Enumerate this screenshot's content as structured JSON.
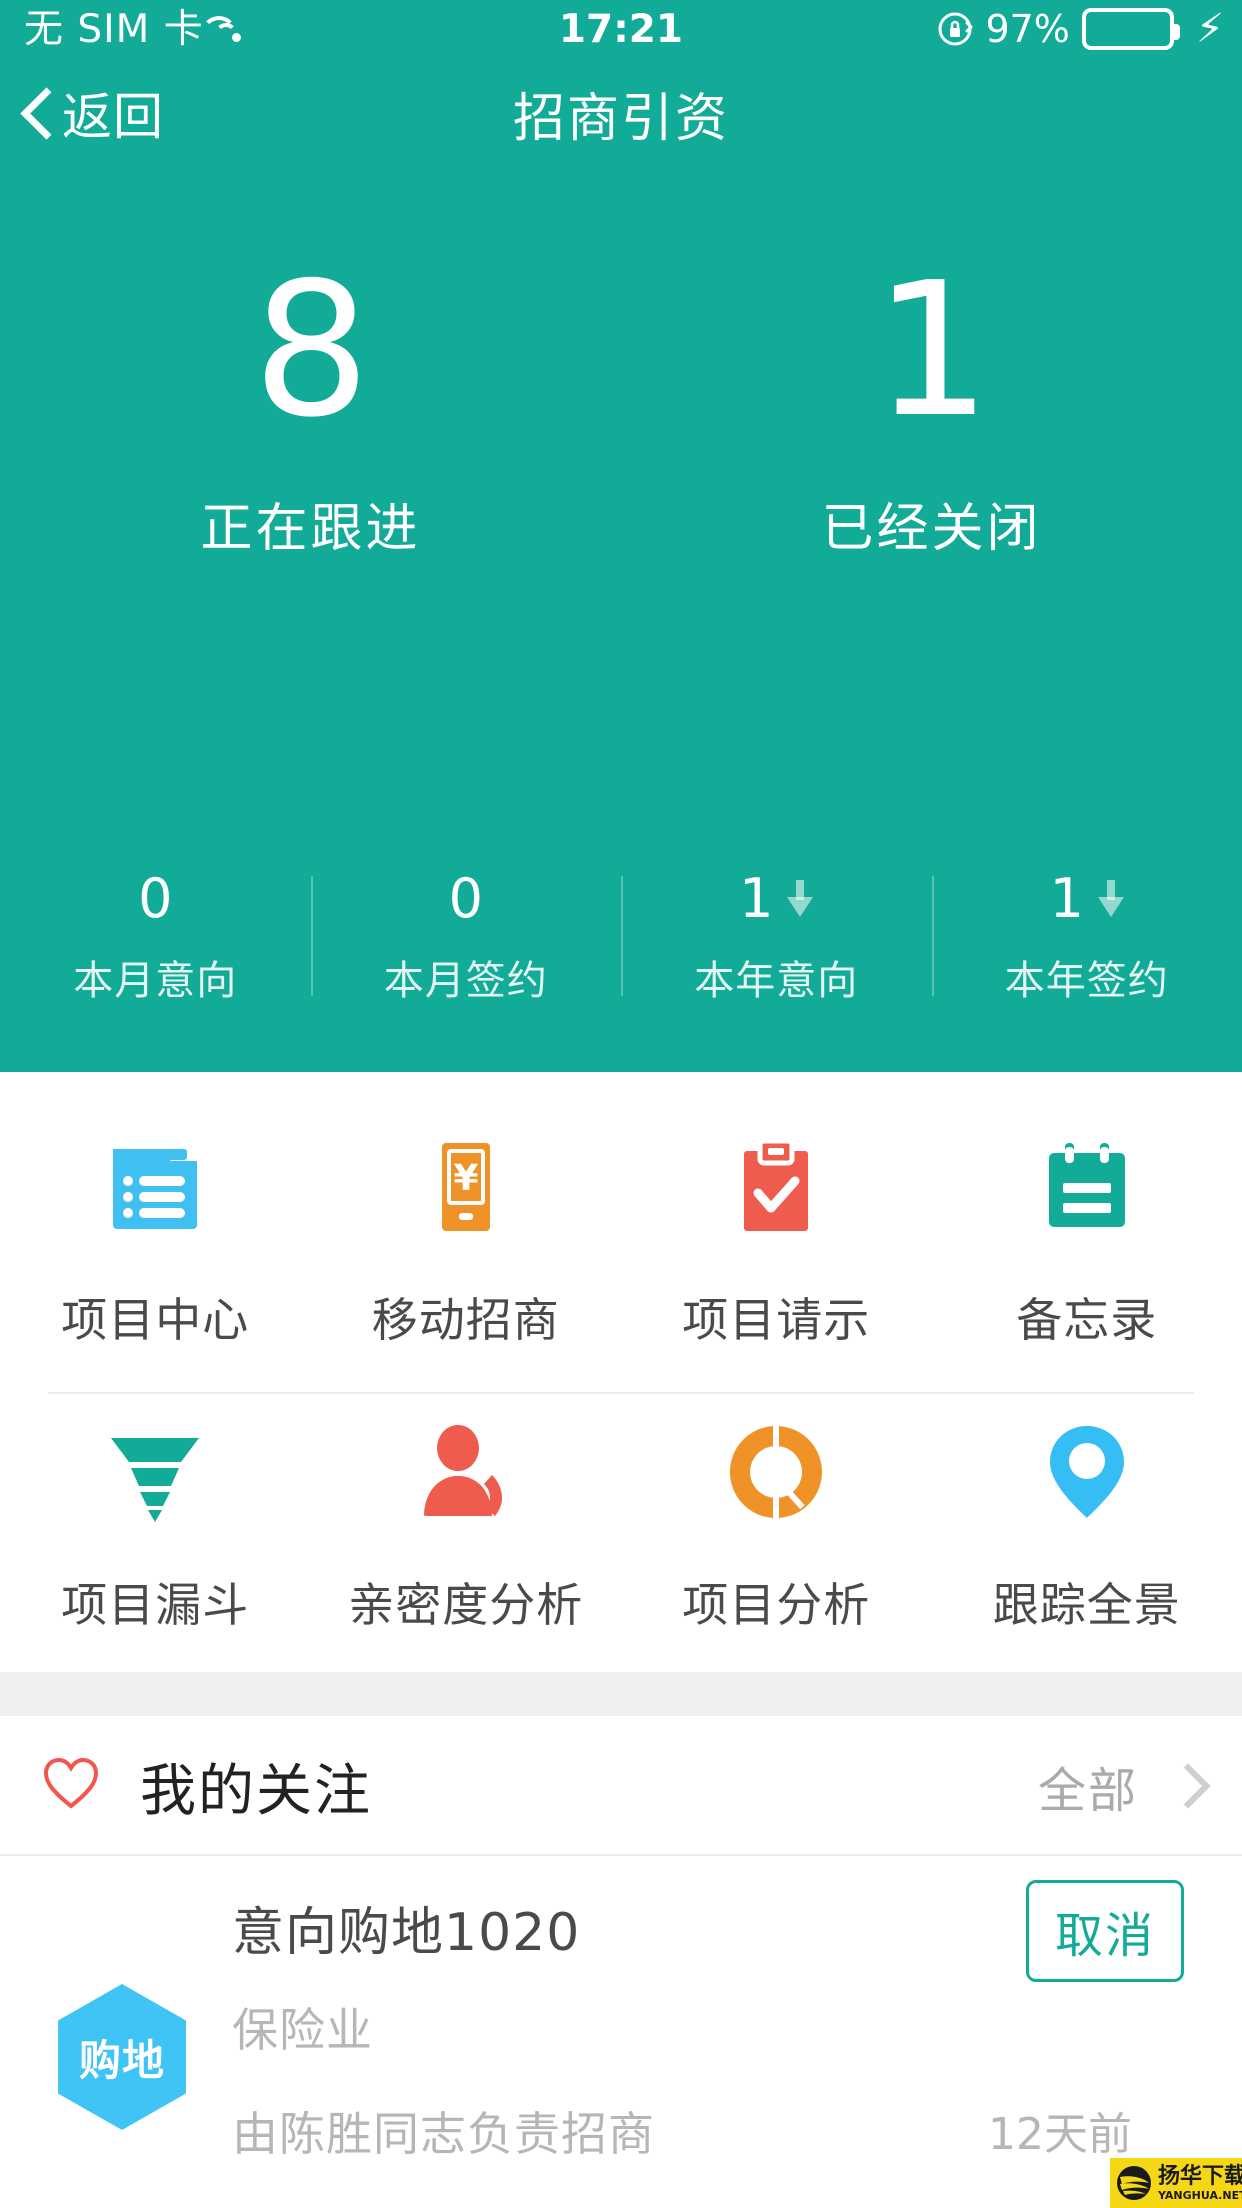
{
  "statusbar": {
    "carrier": "无 SIM 卡",
    "wifi_icon": "wifi-icon",
    "time": "17:21",
    "rotation_lock_icon": "rotation-lock-icon",
    "battery_percent": "97%",
    "battery_level": 97,
    "charging_icon": "lightning-bolt-icon"
  },
  "navbar": {
    "back_icon": "chevron-left-icon",
    "back_label": "返回",
    "title": "招商引资"
  },
  "hero": {
    "bg_color": "#12ab97",
    "big_stats": [
      {
        "value": "8",
        "label": "正在跟进"
      },
      {
        "value": "1",
        "label": "已经关闭"
      }
    ],
    "mini_stats": [
      {
        "value": "0",
        "label": "本月意向",
        "trend": ""
      },
      {
        "value": "0",
        "label": "本月签约",
        "trend": ""
      },
      {
        "value": "1",
        "label": "本年意向",
        "trend": "down"
      },
      {
        "value": "1",
        "label": "本年签约",
        "trend": "down"
      }
    ]
  },
  "grid": {
    "row1": [
      {
        "label": "项目中心",
        "icon": "document-list-icon",
        "color": "#3fc0f0"
      },
      {
        "label": "移动招商",
        "icon": "phone-yuan-icon",
        "color": "#ef9228"
      },
      {
        "label": "项目请示",
        "icon": "clipboard-check-icon",
        "color": "#ef5b4c"
      },
      {
        "label": "备忘录",
        "icon": "calendar-icon",
        "color": "#12ab97"
      }
    ],
    "row2": [
      {
        "label": "项目漏斗",
        "icon": "funnel-icon",
        "color": "#12ab97"
      },
      {
        "label": "亲密度分析",
        "icon": "person-phone-icon",
        "color": "#ef5b4c"
      },
      {
        "label": "项目分析",
        "icon": "donut-chart-icon",
        "color": "#ef9228"
      },
      {
        "label": "跟踪全景",
        "icon": "map-pin-eye-icon",
        "color": "#35bdf4"
      }
    ]
  },
  "focus": {
    "heart_icon": "heart-outline-icon",
    "heart_color": "#f5554a",
    "title": "我的关注",
    "all_label": "全部",
    "chevron_icon": "chevron-right-icon"
  },
  "list": [
    {
      "badge": "购地",
      "badge_color": "#40c4f5",
      "title": "意向购地1020",
      "industry": "保险业",
      "owner": "由陈胜同志负责招商",
      "time": "12天前",
      "action_label": "取消",
      "action_color": "#13ab97"
    }
  ],
  "watermark": {
    "cn": "扬华下载",
    "en": "YANGHUA.NET",
    "bg": "#f5d716",
    "logo_icon": "yanghua-logo-icon"
  }
}
